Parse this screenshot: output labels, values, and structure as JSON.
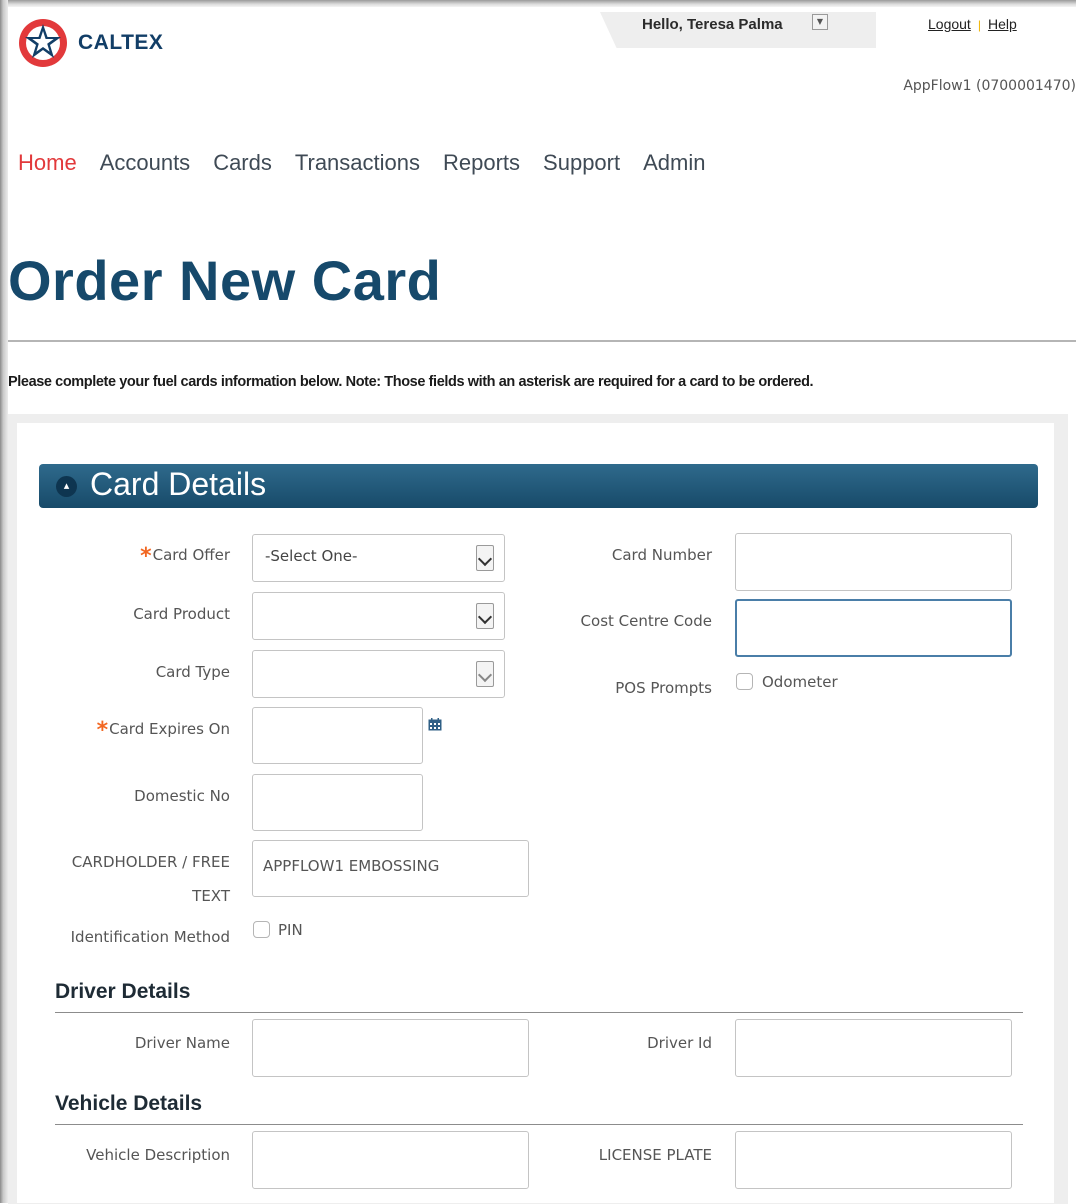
{
  "header": {
    "logo_text": "CALTEX",
    "greeting": "Hello, Teresa Palma",
    "logout": "Logout",
    "help": "Help",
    "account": "AppFlow1 (0700001470)"
  },
  "nav": {
    "items": [
      {
        "label": "Home",
        "active": true
      },
      {
        "label": "Accounts"
      },
      {
        "label": "Cards"
      },
      {
        "label": "Transactions"
      },
      {
        "label": "Reports"
      },
      {
        "label": "Support"
      },
      {
        "label": "Admin"
      }
    ]
  },
  "page": {
    "title": "Order New Card",
    "note": "Please complete your fuel cards information below. Note: Those fields with an asterisk are required for a card to be ordered."
  },
  "card_details": {
    "title": "Card Details",
    "card_offer": {
      "label": "Card Offer",
      "value": "-Select One-",
      "required": true
    },
    "card_product": {
      "label": "Card Product",
      "value": ""
    },
    "card_type": {
      "label": "Card Type",
      "value": ""
    },
    "card_expires_on": {
      "label": "Card Expires On",
      "value": "",
      "required": true
    },
    "domestic_no": {
      "label": "Domestic No",
      "value": ""
    },
    "cardholder_line1": "CARDHOLDER / FREE",
    "cardholder_line2": "TEXT",
    "cardholder_value": "APPFLOW1 EMBOSSING",
    "identification_method": {
      "label": "Identification Method",
      "option": "PIN",
      "checked": false
    },
    "card_number": {
      "label": "Card Number",
      "value": ""
    },
    "cost_centre_code": {
      "label": "Cost Centre Code",
      "value": ""
    },
    "pos_prompts": {
      "label": "POS Prompts",
      "option": "Odometer",
      "checked": false
    }
  },
  "driver_details": {
    "title": "Driver Details",
    "driver_name": {
      "label": "Driver Name",
      "value": ""
    },
    "driver_id": {
      "label": "Driver Id",
      "value": ""
    }
  },
  "vehicle_details": {
    "title": "Vehicle Details",
    "vehicle_description": {
      "label": "Vehicle Description",
      "value": ""
    },
    "license_plate": {
      "label": "LICENSE PLATE",
      "value": ""
    }
  },
  "colors": {
    "brand_navy": "#123e67",
    "brand_red": "#e2393b",
    "title_blue": "#16496b",
    "required_orange": "#f26722",
    "section_bar": "#1f5676"
  },
  "icons": [
    "caltex-star-logo",
    "dropdown-icon",
    "calendar-icon",
    "collapse-icon"
  ]
}
